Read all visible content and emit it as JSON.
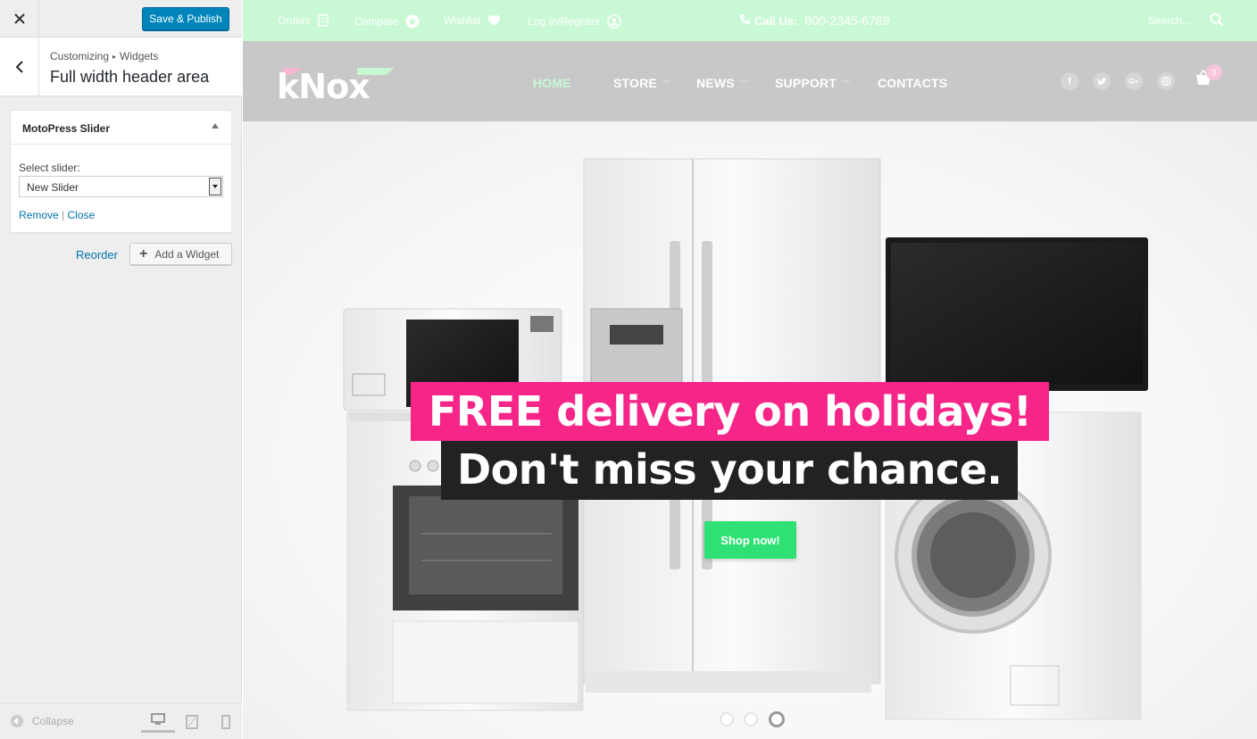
{
  "customizer": {
    "close_icon": "close-icon",
    "publish_label": "Save & Publish",
    "breadcrumb": {
      "root": "Customizing",
      "section": "Widgets"
    },
    "panel_title": "Full width header area",
    "widget": {
      "title": "MotoPress Slider",
      "select_label": "Select slider:",
      "selected_value": "New Slider",
      "remove_label": "Remove",
      "separator": "|",
      "close_label": "Close"
    },
    "reorder_label": "Reorder",
    "add_widget_label": "Add a Widget",
    "collapse_label": "Collapse",
    "devices": [
      "desktop",
      "tablet",
      "mobile"
    ]
  },
  "site": {
    "topbar": {
      "orders": "Orders",
      "compare": "Compare",
      "wishlist": "Wishlist",
      "login": "Log In/Register",
      "call_label": "Call Us:",
      "phone": "800-2345-6789",
      "search_placeholder": "Search..."
    },
    "logo_text": "kNox",
    "nav": {
      "home": "HOME",
      "store": "STORE",
      "news": "NEWS",
      "support": "SUPPORT",
      "contacts": "CONTACTS"
    },
    "cart_count": "0",
    "social": [
      "facebook-icon",
      "twitter-icon",
      "google-plus-icon",
      "instagram-icon"
    ],
    "slider": {
      "headline_1": "FREE delivery on holidays!",
      "headline_2": "Don't miss your chance.",
      "button": "Shop now!",
      "slide_count": 3,
      "active_slide": 3
    },
    "colors": {
      "topbar_bg": "#c9f8d5",
      "navbar_bg": "#c8c8c8",
      "accent_pink": "#f52688",
      "accent_green": "#2fe174",
      "wp_blue": "#0085ba"
    }
  }
}
